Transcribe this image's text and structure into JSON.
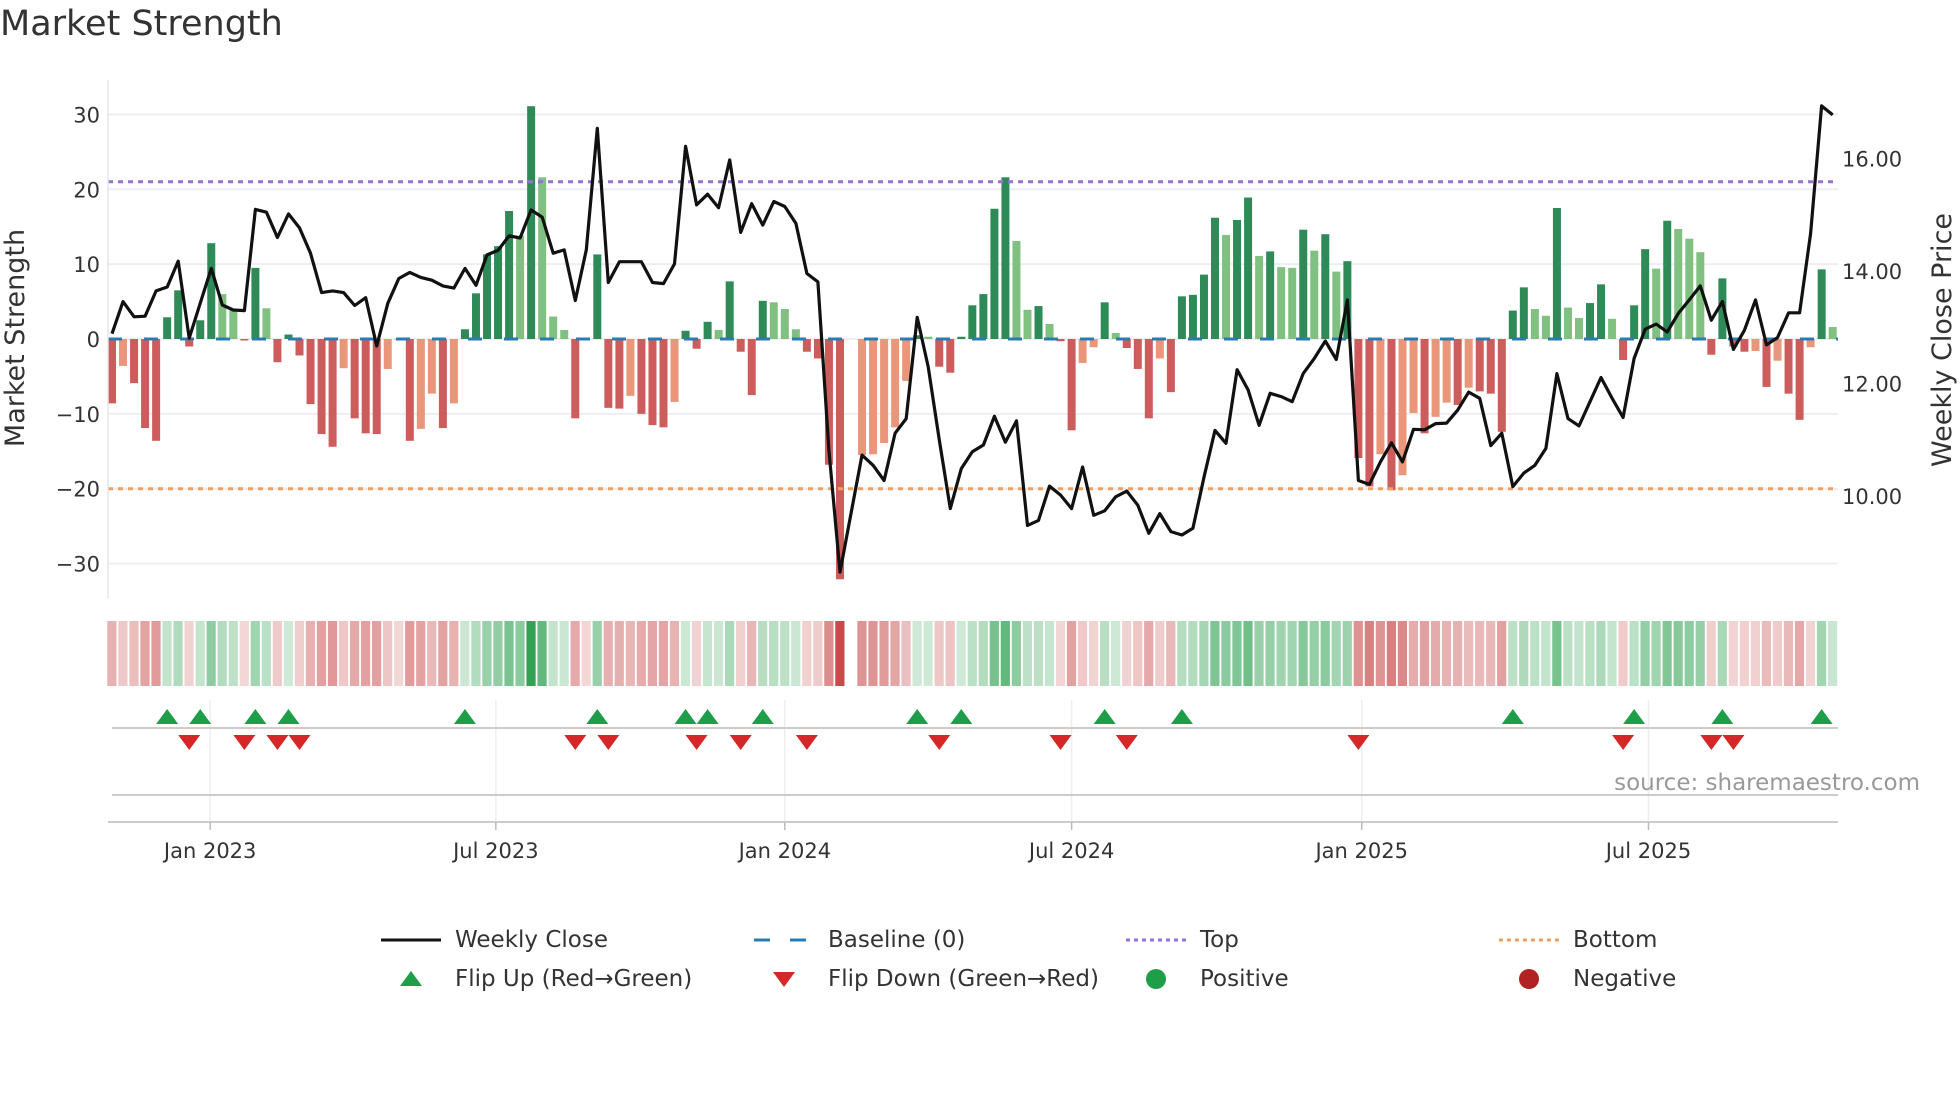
{
  "title": "Market Strength",
  "source": "source: sharemaestro.com",
  "legend": [
    {
      "label": "Weekly Close",
      "symbol": "line"
    },
    {
      "label": "Baseline (0)",
      "symbol": "dash"
    },
    {
      "label": "Top",
      "symbol": "dot-purple"
    },
    {
      "label": "Bottom",
      "symbol": "dot-orange"
    },
    {
      "label": "Flip Up (Red→Green)",
      "symbol": "triangle-up"
    },
    {
      "label": "Flip Down (Green→Red)",
      "symbol": "triangle-down"
    },
    {
      "label": "Positive",
      "symbol": "circle-green"
    },
    {
      "label": "Negative",
      "symbol": "circle-red"
    }
  ],
  "colors": {
    "pos_rising": "#2e8b57",
    "pos_falling": "#80c080",
    "neg_falling": "#cd5c5c",
    "neg_rising": "#e9967a",
    "close": "#111111",
    "baseline": "#2b7bb0",
    "top": "#9a6fd8",
    "bottom": "#f0a060",
    "flip_up": "#1f9e4a",
    "flip_down": "#d62728",
    "positive": "#1f9e4a",
    "negative": "#b22222"
  },
  "chart_data": {
    "type": "bar+line",
    "title": "Market Strength",
    "ylabel": "Market Strength",
    "ylabel2": "Weekly Close Price",
    "ylim": [
      -34.6,
      34.6
    ],
    "ylim2": [
      8.19,
      17.4
    ],
    "yticks": [
      30,
      20,
      10,
      0,
      -10,
      -20,
      -30
    ],
    "yticks2": [
      "16.00",
      "14.00",
      "12.00",
      "10.00"
    ],
    "top": 21,
    "bottom": -20,
    "baseline": 0,
    "x_ticks": [
      {
        "label": "Jan 2023",
        "week": 9.9
      },
      {
        "label": "Jul 2023",
        "week": 35.8
      },
      {
        "label": "Jan 2024",
        "week": 62.0
      },
      {
        "label": "Jul 2024",
        "week": 88.0
      },
      {
        "label": "Jan 2025",
        "week": 114.3
      },
      {
        "label": "Jul 2025",
        "week": 140.3
      }
    ],
    "strength": [
      -8.6,
      -3.6,
      -5.9,
      -11.9,
      -13.6,
      2.9,
      6.5,
      -1.0,
      2.5,
      12.8,
      6.0,
      3.8,
      -0.2,
      9.5,
      4.1,
      -3.1,
      0.6,
      -2.2,
      -8.7,
      -12.7,
      -14.4,
      -3.9,
      -10.6,
      -12.6,
      -12.7,
      -4.0,
      -0.1,
      -13.6,
      -12.0,
      -7.3,
      -11.9,
      -8.6,
      1.3,
      6.1,
      11.3,
      12.4,
      17.1,
      13.8,
      31.1,
      21.6,
      3.0,
      1.2,
      -10.6,
      -0.1,
      11.3,
      -9.2,
      -9.3,
      -7.6,
      -10.0,
      -11.5,
      -11.8,
      -8.4,
      1.1,
      -1.3,
      2.3,
      1.2,
      7.7,
      -1.7,
      -7.5,
      5.1,
      4.9,
      4.0,
      1.3,
      -1.7,
      -2.6,
      -16.8,
      -32.1,
      null,
      -15.5,
      -15.4,
      -13.9,
      -11.8,
      -5.6,
      0.5,
      0.3,
      -3.7,
      -4.5,
      0.3,
      4.5,
      6.0,
      17.4,
      21.6,
      13.1,
      3.9,
      4.4,
      2.0,
      -0.3,
      -12.2,
      -3.2,
      -1.1,
      4.9,
      0.8,
      -1.2,
      -4.0,
      -10.6,
      -2.6,
      -7.1,
      5.7,
      5.9,
      8.6,
      16.2,
      13.9,
      15.9,
      18.9,
      11.1,
      11.7,
      9.6,
      9.5,
      14.6,
      11.8,
      14.0,
      9.0,
      10.4,
      -15.9,
      -19.7,
      -15.4,
      -20.2,
      -18.2,
      -9.9,
      -12.6,
      -10.4,
      -8.5,
      -8.8,
      -6.5,
      -7.0,
      -7.3,
      -12.4,
      3.8,
      6.9,
      4.0,
      3.1,
      17.5,
      4.2,
      2.8,
      4.8,
      7.3,
      2.7,
      -2.8,
      4.5,
      12.0,
      9.4,
      15.8,
      14.7,
      13.4,
      11.6,
      -2.1,
      8.1,
      -1.0,
      -1.7,
      -1.6,
      -6.4,
      -2.9,
      -7.3,
      -10.8,
      -1.1,
      9.3,
      1.6
    ],
    "close": [
      12.89,
      13.46,
      13.19,
      13.2,
      13.65,
      13.72,
      14.18,
      12.81,
      13.43,
      14.05,
      13.4,
      13.31,
      13.3,
      15.1,
      15.05,
      14.6,
      15.02,
      14.77,
      14.32,
      13.62,
      13.65,
      13.62,
      13.39,
      13.53,
      12.67,
      13.43,
      13.87,
      13.98,
      13.89,
      13.84,
      13.74,
      13.7,
      14.05,
      13.75,
      14.29,
      14.37,
      14.63,
      14.59,
      15.09,
      14.96,
      14.32,
      14.38,
      13.48,
      14.38,
      16.54,
      13.8,
      14.17,
      14.17,
      14.17,
      13.8,
      13.78,
      14.13,
      16.22,
      15.18,
      15.37,
      15.13,
      15.98,
      14.69,
      15.2,
      14.82,
      15.24,
      15.15,
      14.85,
      13.96,
      13.81,
      10.82,
      8.65,
      9.69,
      10.73,
      10.55,
      10.28,
      11.12,
      11.38,
      13.18,
      12.3,
      11.0,
      9.78,
      10.49,
      10.79,
      10.91,
      11.42,
      10.96,
      11.34,
      9.48,
      9.57,
      10.18,
      10.02,
      9.78,
      10.52,
      9.66,
      9.74,
      9.99,
      10.09,
      9.84,
      9.34,
      9.69,
      9.37,
      9.31,
      9.43,
      10.34,
      11.17,
      10.94,
      12.25,
      11.89,
      11.26,
      11.83,
      11.77,
      11.68,
      12.18,
      12.45,
      12.76,
      12.43,
      13.49,
      10.28,
      10.21,
      10.61,
      10.95,
      10.61,
      11.19,
      11.18,
      11.29,
      11.3,
      11.53,
      11.85,
      11.74,
      10.9,
      11.12,
      10.17,
      10.41,
      10.55,
      10.85,
      12.18,
      11.38,
      11.25,
      11.68,
      12.11,
      11.74,
      11.4,
      12.45,
      12.97,
      13.06,
      12.92,
      13.25,
      13.49,
      13.74,
      13.13,
      13.46,
      12.61,
      12.95,
      13.49,
      12.69,
      12.82,
      13.26,
      13.26,
      14.67,
      16.94,
      16.78
    ]
  }
}
